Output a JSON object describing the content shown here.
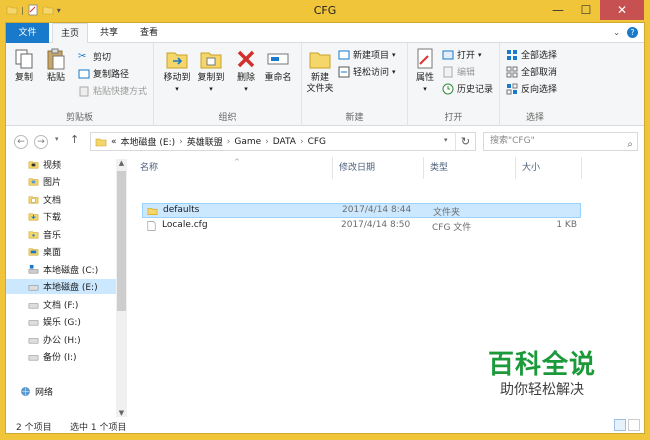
{
  "window": {
    "title": "CFG",
    "colors": {
      "frame": "#f0c53a",
      "accent": "#1979ca"
    }
  },
  "quick_access": [
    {
      "icon": "folder-icon"
    },
    {
      "icon": "properties-icon"
    },
    {
      "icon": "new-folder-icon"
    }
  ],
  "tabs": [
    "文件",
    "主页",
    "共享",
    "查看"
  ],
  "ribbon": {
    "clipboard": {
      "copy": "复制",
      "paste": "粘贴",
      "cut": "剪切",
      "copy_path": "复制路径",
      "paste_shortcut": "粘贴快捷方式",
      "label": "剪贴板"
    },
    "organize": {
      "move_to": "移动到",
      "copy_to": "复制到",
      "delete": "删除",
      "rename": "重命名",
      "label": "组织"
    },
    "new": {
      "new_folder_line1": "新建",
      "new_folder_line2": "文件夹",
      "new_item": "新建项目",
      "easy_access": "轻松访问",
      "label": "新建"
    },
    "open": {
      "properties": "属性",
      "open": "打开",
      "edit": "编辑",
      "history": "历史记录",
      "label": "打开"
    },
    "select": {
      "select_all": "全部选择",
      "select_none": "全部取消",
      "invert": "反向选择",
      "label": "选择"
    }
  },
  "address": {
    "prefix": "«",
    "crumbs": [
      "本地磁盘 (E:)",
      "英雄联盟",
      "Game",
      "DATA",
      "CFG"
    ],
    "separator": "›",
    "search_placeholder": "搜索\"CFG\""
  },
  "nav_items": [
    {
      "label": "视频",
      "icon": "video-folder-icon"
    },
    {
      "label": "图片",
      "icon": "pictures-folder-icon"
    },
    {
      "label": "文档",
      "icon": "documents-folder-icon"
    },
    {
      "label": "下载",
      "icon": "downloads-folder-icon"
    },
    {
      "label": "音乐",
      "icon": "music-folder-icon"
    },
    {
      "label": "桌面",
      "icon": "desktop-folder-icon"
    },
    {
      "label": "本地磁盘 (C:)",
      "icon": "system-drive-icon"
    },
    {
      "label": "本地磁盘 (E:)",
      "icon": "drive-icon",
      "selected": true
    },
    {
      "label": "文档 (F:)",
      "icon": "drive-icon"
    },
    {
      "label": "娱乐 (G:)",
      "icon": "drive-icon"
    },
    {
      "label": "办公 (H:)",
      "icon": "drive-icon"
    },
    {
      "label": "备份 (I:)",
      "icon": "drive-icon"
    },
    {
      "label": "网络",
      "icon": "network-icon"
    }
  ],
  "columns": [
    "名称",
    "修改日期",
    "类型",
    "大小"
  ],
  "files": [
    {
      "name": "defaults",
      "modified": "2017/4/14 8:44",
      "type": "文件夹",
      "size": "",
      "icon": "folder-icon",
      "selected": true
    },
    {
      "name": "Locale.cfg",
      "modified": "2017/4/14 8:50",
      "type": "CFG 文件",
      "size": "1 KB",
      "icon": "file-icon",
      "selected": false
    }
  ],
  "status": {
    "count": "2 个项目",
    "selected": "选中 1 个项目"
  },
  "watermark": {
    "line1": "百科全说",
    "line2": "助你轻松解决"
  }
}
